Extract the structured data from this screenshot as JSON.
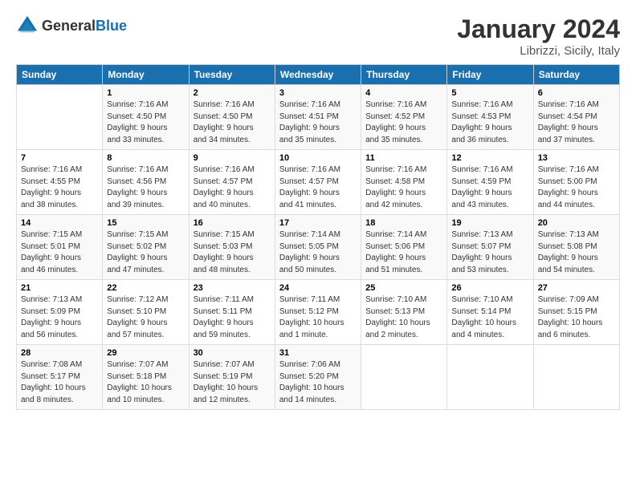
{
  "header": {
    "logo_general": "General",
    "logo_blue": "Blue",
    "title": "January 2024",
    "subtitle": "Librizzi, Sicily, Italy"
  },
  "columns": [
    "Sunday",
    "Monday",
    "Tuesday",
    "Wednesday",
    "Thursday",
    "Friday",
    "Saturday"
  ],
  "weeks": [
    [
      {
        "day": "",
        "detail": ""
      },
      {
        "day": "1",
        "detail": "Sunrise: 7:16 AM\nSunset: 4:50 PM\nDaylight: 9 hours\nand 33 minutes."
      },
      {
        "day": "2",
        "detail": "Sunrise: 7:16 AM\nSunset: 4:50 PM\nDaylight: 9 hours\nand 34 minutes."
      },
      {
        "day": "3",
        "detail": "Sunrise: 7:16 AM\nSunset: 4:51 PM\nDaylight: 9 hours\nand 35 minutes."
      },
      {
        "day": "4",
        "detail": "Sunrise: 7:16 AM\nSunset: 4:52 PM\nDaylight: 9 hours\nand 35 minutes."
      },
      {
        "day": "5",
        "detail": "Sunrise: 7:16 AM\nSunset: 4:53 PM\nDaylight: 9 hours\nand 36 minutes."
      },
      {
        "day": "6",
        "detail": "Sunrise: 7:16 AM\nSunset: 4:54 PM\nDaylight: 9 hours\nand 37 minutes."
      }
    ],
    [
      {
        "day": "7",
        "detail": "Sunrise: 7:16 AM\nSunset: 4:55 PM\nDaylight: 9 hours\nand 38 minutes."
      },
      {
        "day": "8",
        "detail": "Sunrise: 7:16 AM\nSunset: 4:56 PM\nDaylight: 9 hours\nand 39 minutes."
      },
      {
        "day": "9",
        "detail": "Sunrise: 7:16 AM\nSunset: 4:57 PM\nDaylight: 9 hours\nand 40 minutes."
      },
      {
        "day": "10",
        "detail": "Sunrise: 7:16 AM\nSunset: 4:57 PM\nDaylight: 9 hours\nand 41 minutes."
      },
      {
        "day": "11",
        "detail": "Sunrise: 7:16 AM\nSunset: 4:58 PM\nDaylight: 9 hours\nand 42 minutes."
      },
      {
        "day": "12",
        "detail": "Sunrise: 7:16 AM\nSunset: 4:59 PM\nDaylight: 9 hours\nand 43 minutes."
      },
      {
        "day": "13",
        "detail": "Sunrise: 7:16 AM\nSunset: 5:00 PM\nDaylight: 9 hours\nand 44 minutes."
      }
    ],
    [
      {
        "day": "14",
        "detail": "Sunrise: 7:15 AM\nSunset: 5:01 PM\nDaylight: 9 hours\nand 46 minutes."
      },
      {
        "day": "15",
        "detail": "Sunrise: 7:15 AM\nSunset: 5:02 PM\nDaylight: 9 hours\nand 47 minutes."
      },
      {
        "day": "16",
        "detail": "Sunrise: 7:15 AM\nSunset: 5:03 PM\nDaylight: 9 hours\nand 48 minutes."
      },
      {
        "day": "17",
        "detail": "Sunrise: 7:14 AM\nSunset: 5:05 PM\nDaylight: 9 hours\nand 50 minutes."
      },
      {
        "day": "18",
        "detail": "Sunrise: 7:14 AM\nSunset: 5:06 PM\nDaylight: 9 hours\nand 51 minutes."
      },
      {
        "day": "19",
        "detail": "Sunrise: 7:13 AM\nSunset: 5:07 PM\nDaylight: 9 hours\nand 53 minutes."
      },
      {
        "day": "20",
        "detail": "Sunrise: 7:13 AM\nSunset: 5:08 PM\nDaylight: 9 hours\nand 54 minutes."
      }
    ],
    [
      {
        "day": "21",
        "detail": "Sunrise: 7:13 AM\nSunset: 5:09 PM\nDaylight: 9 hours\nand 56 minutes."
      },
      {
        "day": "22",
        "detail": "Sunrise: 7:12 AM\nSunset: 5:10 PM\nDaylight: 9 hours\nand 57 minutes."
      },
      {
        "day": "23",
        "detail": "Sunrise: 7:11 AM\nSunset: 5:11 PM\nDaylight: 9 hours\nand 59 minutes."
      },
      {
        "day": "24",
        "detail": "Sunrise: 7:11 AM\nSunset: 5:12 PM\nDaylight: 10 hours\nand 1 minute."
      },
      {
        "day": "25",
        "detail": "Sunrise: 7:10 AM\nSunset: 5:13 PM\nDaylight: 10 hours\nand 2 minutes."
      },
      {
        "day": "26",
        "detail": "Sunrise: 7:10 AM\nSunset: 5:14 PM\nDaylight: 10 hours\nand 4 minutes."
      },
      {
        "day": "27",
        "detail": "Sunrise: 7:09 AM\nSunset: 5:15 PM\nDaylight: 10 hours\nand 6 minutes."
      }
    ],
    [
      {
        "day": "28",
        "detail": "Sunrise: 7:08 AM\nSunset: 5:17 PM\nDaylight: 10 hours\nand 8 minutes."
      },
      {
        "day": "29",
        "detail": "Sunrise: 7:07 AM\nSunset: 5:18 PM\nDaylight: 10 hours\nand 10 minutes."
      },
      {
        "day": "30",
        "detail": "Sunrise: 7:07 AM\nSunset: 5:19 PM\nDaylight: 10 hours\nand 12 minutes."
      },
      {
        "day": "31",
        "detail": "Sunrise: 7:06 AM\nSunset: 5:20 PM\nDaylight: 10 hours\nand 14 minutes."
      },
      {
        "day": "",
        "detail": ""
      },
      {
        "day": "",
        "detail": ""
      },
      {
        "day": "",
        "detail": ""
      }
    ]
  ]
}
